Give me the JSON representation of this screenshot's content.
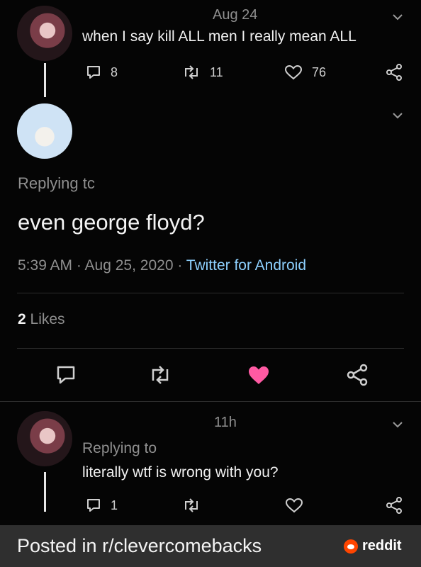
{
  "tweet1": {
    "date": "Aug 24",
    "text": "when I say kill ALL men I really mean ALL",
    "replies": "8",
    "retweets": "11",
    "likes": "76"
  },
  "tweet2": {
    "replying": "Replying tc",
    "text": "even george floyd?",
    "time": "5:39 AM · Aug 25, 2020 · ",
    "source": "Twitter for Android",
    "likes_count": "2",
    "likes_label": "Likes"
  },
  "tweet3": {
    "time": "11h",
    "replying": "Replying to",
    "text": "literally wtf is wrong with you?",
    "replies": "1"
  },
  "footer": {
    "posted": "Posted in r/clevercomebacks",
    "brand": "reddit"
  },
  "colors": {
    "accent_blue": "#1da1f2",
    "like_pink": "#ff5aa3",
    "reddit_orange": "#ff4500"
  }
}
